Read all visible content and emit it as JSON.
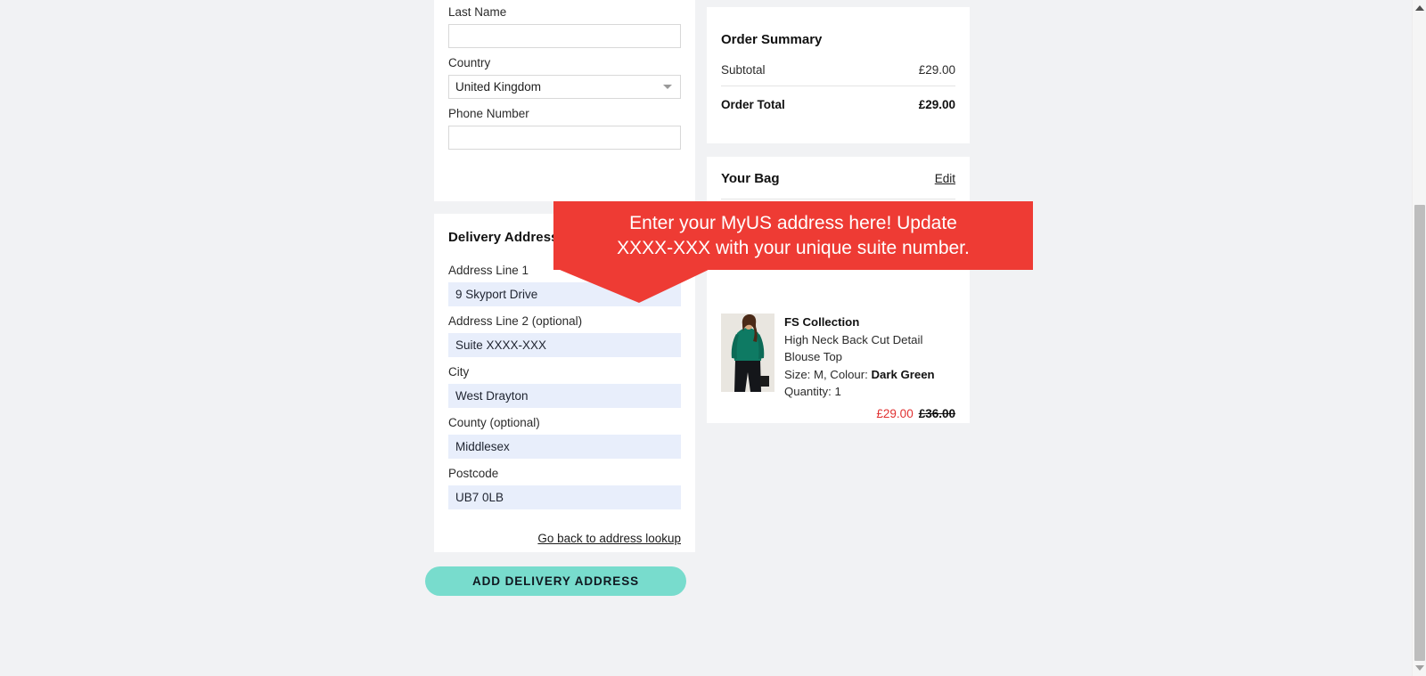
{
  "colors": {
    "page_background": "#f1f2f4",
    "card_background": "#ffffff",
    "callout_red": "#ee3b34",
    "button_teal": "#78dccd",
    "autofill_blue": "#e8eefb",
    "sale_red": "#e03131"
  },
  "personal_form": {
    "fields": [
      {
        "label": "",
        "value": "",
        "placeholder": ""
      },
      {
        "label": "Last Name",
        "value": "",
        "placeholder": ""
      },
      {
        "label": "Country",
        "value": "United Kingdom",
        "placeholder": ""
      },
      {
        "label": "Phone Number",
        "value": "",
        "placeholder": ""
      }
    ],
    "country_caret_icon": "chevron-down-icon"
  },
  "delivery": {
    "title": "Delivery Address",
    "fields": [
      {
        "label": "Address Line 1",
        "value": "9 Skyport Drive",
        "placeholder": ""
      },
      {
        "label": "Address Line 2 (optional)",
        "value": "Suite XXXX-XXX",
        "placeholder": ""
      },
      {
        "label": "City",
        "value": "West Drayton",
        "placeholder": ""
      },
      {
        "label": "County (optional)",
        "value": "Middlesex",
        "placeholder": ""
      },
      {
        "label": "Postcode",
        "value": "UB7 0LB",
        "placeholder": ""
      }
    ],
    "lookup_link": "Go back to address lookup",
    "submit_label": "ADD DELIVERY ADDRESS"
  },
  "order_summary": {
    "title": "Order Summary",
    "subtotal_label": "Subtotal",
    "subtotal_value": "£29.00",
    "total_label": "Order Total",
    "total_value": "£29.00"
  },
  "bag": {
    "title": "Your Bag",
    "edit_label": "Edit",
    "item": {
      "brand": "FS Collection",
      "name_line_1": "High Neck Back Cut Detail",
      "name_line_2": "Blouse Top",
      "size_prefix": "Size: M, Colour: ",
      "colour": "Dark Green",
      "quantity": "Quantity: 1",
      "price_sale": "£29.00",
      "price_was": "£36.00",
      "thumb_alt": "product-thumbnail"
    }
  },
  "callout": {
    "text": "Enter your MyUS address here! Update\nXXXX-XXX with your unique suite number."
  },
  "scrollbar": {
    "up_icon": "scroll-up-arrow-icon",
    "down_icon": "scroll-down-arrow-icon"
  }
}
